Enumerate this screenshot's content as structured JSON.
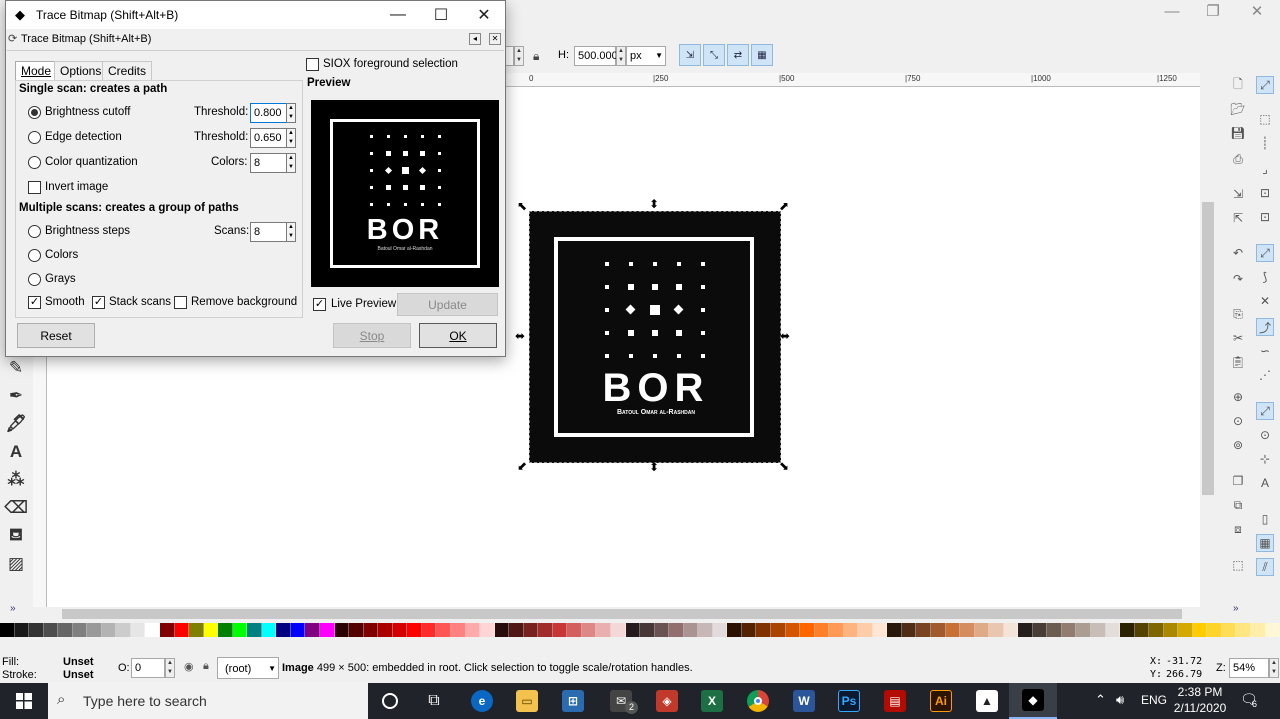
{
  "main_window": {
    "controls": {
      "minimize": "—",
      "restore": "❐",
      "close": "✕"
    }
  },
  "toolbar": {
    "h_label": "H:",
    "h_value": "500.000",
    "unit_value": "px"
  },
  "ruler": {
    "ticks": [
      "0",
      "|250",
      "|500",
      "|750",
      "|1000",
      "|1250"
    ]
  },
  "logo": {
    "title": "BOR",
    "subtitle": "Batoul Omar al-Rashdan"
  },
  "dialog": {
    "title": "Trace Bitmap (Shift+Alt+B)",
    "panel_title": "Trace Bitmap (Shift+Alt+B)",
    "tabs": [
      "Mode",
      "Options",
      "Credits"
    ],
    "single_scan_heading": "Single scan: creates a path",
    "brightness_cutoff": "Brightness cutoff",
    "edge_detection": "Edge detection",
    "color_quantization": "Color quantization",
    "invert_image": "Invert image",
    "threshold_label": "Threshold:",
    "threshold_1": "0.800",
    "threshold_2": "0.650",
    "colors_label": "Colors:",
    "colors_value": "8",
    "multi_scan_heading": "Multiple scans: creates a group of paths",
    "brightness_steps": "Brightness steps",
    "scans_label": "Scans:",
    "scans_value": "8",
    "colors_option": "Colors",
    "grays_option": "Grays",
    "smooth": "Smooth",
    "stack_scans": "Stack scans",
    "remove_background": "Remove background",
    "siox": "SIOX foreground selection",
    "preview_heading": "Preview",
    "live_preview": "Live Preview",
    "update_button": "Update",
    "reset_button": "Reset",
    "stop_button": "Stop",
    "ok_button": "OK"
  },
  "status_bar": {
    "fill_label": "Fill:",
    "fill_value": "Unset",
    "stroke_label": "Stroke:",
    "stroke_value": "Unset",
    "opacity_label": "O:",
    "opacity_value": "0",
    "layer_value": "(root)",
    "message_bold": "Image",
    "message": "499 × 500: embedded in root. Click selection to toggle scale/rotation handles.",
    "x_label": "X:",
    "x_value": "-31.72",
    "y_label": "Y:",
    "y_value": "266.79",
    "zoom_label": "Z:",
    "zoom_value": "54%"
  },
  "taskbar": {
    "search_placeholder": "Type here to search",
    "language": "ENG",
    "time": "2:38 PM",
    "date": "2/11/2020",
    "notification_count": "6",
    "mail_badge": "2"
  },
  "palette_colors": [
    "#000000",
    "#1a1a1a",
    "#333333",
    "#4d4d4d",
    "#666666",
    "#808080",
    "#999999",
    "#b3b3b3",
    "#cccccc",
    "#e6e6e6",
    "#ffffff",
    "#800000",
    "#ff0000",
    "#808000",
    "#ffff00",
    "#008000",
    "#00ff00",
    "#008080",
    "#00ffff",
    "#000080",
    "#0000ff",
    "#800080",
    "#ff00ff",
    "#2b0000",
    "#550000",
    "#800000",
    "#aa0000",
    "#d40000",
    "#ff0000",
    "#ff2a2a",
    "#ff5555",
    "#ff8080",
    "#ffaaaa",
    "#ffd5d5",
    "#280b0b",
    "#501616",
    "#782121",
    "#a02c2c",
    "#c83737",
    "#d35f5f",
    "#de8787",
    "#e9afaf",
    "#f4d7d7",
    "#241c1c",
    "#483737",
    "#6c5353",
    "#916f6f",
    "#ac9393",
    "#c8b7b7",
    "#e3dbdb",
    "#2b1100",
    "#552200",
    "#803300",
    "#aa4400",
    "#d45500",
    "#ff6600",
    "#ff7f2a",
    "#ff9955",
    "#ffb380",
    "#ffccaa",
    "#ffe6d5",
    "#28170b",
    "#502d16",
    "#784421",
    "#a05a2c",
    "#c87137",
    "#d38d5f",
    "#deaa87",
    "#e9c6af",
    "#f4e3d7",
    "#241f1c",
    "#483e37",
    "#6c5d53",
    "#917c6f",
    "#ac9d93",
    "#c8beb7",
    "#e3dedb",
    "#2b2200",
    "#554400",
    "#806600",
    "#aa8800",
    "#d4aa00",
    "#ffcc00",
    "#ffd42a",
    "#ffdd55",
    "#ffe680",
    "#ffeeaa",
    "#fff6d5"
  ]
}
